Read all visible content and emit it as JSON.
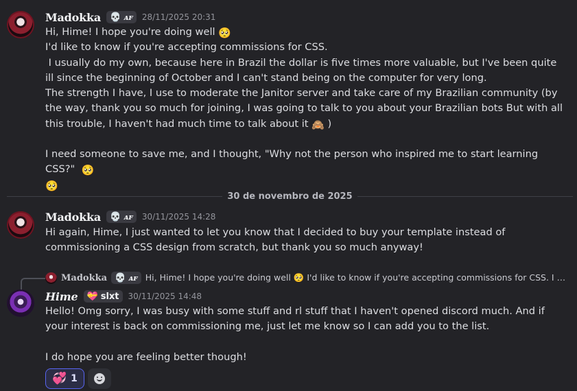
{
  "messages": [
    {
      "author": "Madokka",
      "tag_glyph": "💀",
      "tag_text": "ᴀꜰ",
      "timestamp": "28/11/2025 20:31",
      "lines": [
        "Hi, Hime! I hope you're doing well",
        "I'd like to know if you're accepting commissions for CSS.",
        " I usually do my own, because here in Brazil the dollar is five times more valuable, but I've been quite ill since the beginning of October and I can't stand being on the computer for very long.",
        "The strength I have, I use to moderate the Janitor server and take care of my Brazilian community (by the way, thank you so much for joining, I was going to talk to you about your Brazilian bots But with all this trouble, I haven't had much time to talk about it",
        "I need someone to save me, and I thought, \"Why not the person who inspired me to start learning CSS?\""
      ]
    },
    {
      "author": "Madokka",
      "tag_glyph": "💀",
      "tag_text": "ᴀꜰ",
      "timestamp": "30/11/2025 14:28",
      "lines": [
        "Hi again, Hime, I just wanted to let you know that I decided to buy your template instead of commissioning a CSS design from scratch, but thank you so much anyway!"
      ]
    },
    {
      "author": "Hime",
      "tag_glyph": "💝",
      "tag_text": "slxt",
      "timestamp": "30/11/2025 14:48",
      "reply": {
        "author": "Madokka",
        "tag_text": "ᴀꜰ",
        "preview": "Hi, Hime! I hope you're doing well 🥺 I'd like to know if you're accepting commissions for CSS.  I usually do my own, because here in Brazil"
      },
      "lines": [
        "Hello! Omg sorry, I was busy with some stuff and rl stuff that I haven't opened discord much. And if your interest is back on commissioning me, just let me know so I can add you to the list.",
        "I do hope you are feeling better though!"
      ],
      "reactions": [
        {
          "glyph": "💞",
          "count": "1"
        }
      ]
    }
  ],
  "divider_date": "30 de novembro de 2025",
  "emoji": {
    "plead": "🥺",
    "shy": "🙈",
    "close_paren": ")"
  }
}
